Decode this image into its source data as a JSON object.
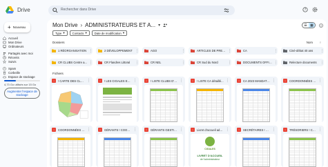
{
  "app": {
    "title": "Drive"
  },
  "search": {
    "placeholder": "Rechercher dans Drive"
  },
  "sidebar": {
    "new_label": "Nouveau",
    "items": [
      {
        "label": "Accueil",
        "icon": "home-icon"
      },
      {
        "label": "Mon Drive",
        "icon": "drive-icon"
      },
      {
        "label": "Ordinateurs",
        "icon": "computer-icon"
      },
      {
        "label": "Partagés avec moi",
        "icon": "people-icon"
      },
      {
        "label": "Récents",
        "icon": "clock-icon"
      },
      {
        "label": "Suivis",
        "icon": "star-icon"
      },
      {
        "label": "Spam",
        "icon": "spam-icon"
      },
      {
        "label": "Corbeille",
        "icon": "trash-icon"
      },
      {
        "label": "Espace de stockage",
        "icon": "cloud-icon"
      }
    ],
    "storage_text": "4,73 Go utilisés sur 15 Go",
    "storage_fraction": 0.32,
    "storage_button": "Augmenter l'espace de stockage"
  },
  "breadcrumb": {
    "root": "Mon Drive",
    "separator": "›",
    "current": "ADMINISTRATEURS ET A..."
  },
  "filters": {
    "type": "Type",
    "contacts": "Contacts",
    "modified": "Date de modification"
  },
  "sections": {
    "folders": "Dossiers",
    "files": "Fichiers"
  },
  "sort": {
    "label": "Nom",
    "direction": "↑"
  },
  "folders": [
    {
      "name": "1 RÉORGANISATION",
      "color": "#f4b400"
    },
    {
      "name": "2 DÉVELOPPEMENT",
      "color": "#f4b400"
    },
    {
      "name": "AGO",
      "color": "#db4437"
    },
    {
      "name": "ARTICLES DE PRESSE",
      "color": "#db4437"
    },
    {
      "name": "CA",
      "color": "#db4437"
    },
    {
      "name": "Ciné-débat 40 ans",
      "color": "#5f6368"
    },
    {
      "name": "CR CLUBS Centre a...",
      "color": "#f4b400"
    },
    {
      "name": "CR Flandres Littoral",
      "color": "#db4437"
    },
    {
      "name": "CR NEL",
      "color": "#db4437"
    },
    {
      "name": "CR Sud du Nord",
      "color": "#db4437"
    },
    {
      "name": "DOCUMENTS OFFIC...",
      "color": "#db4437"
    },
    {
      "name": "Relecture documents",
      "color": "#5f6368"
    }
  ],
  "files": [
    {
      "name": "! CARTE DES CLUB..."
    },
    {
      "name": "! LES CIGALES EN ..."
    },
    {
      "name": "! LISTE CLUBS D'A..."
    },
    {
      "name": "! LISTE CA détaillé..."
    },
    {
      "name": "CA 2023 MANDATS..."
    },
    {
      "name": "COORDONNÉES AD..."
    },
    {
      "name": "COORDONNÉES CL..."
    },
    {
      "name": "GÉRANTS ! COOR..."
    },
    {
      "name": "GÉRANTS GESTION..."
    },
    {
      "name": "Livret d'accueil adm..."
    },
    {
      "name": "SECRÉTAIRES ! CE..."
    },
    {
      "name": "TRÉSORIERS ! CE..."
    }
  ],
  "livret": {
    "brand": "CIGALES",
    "heading": "LIVRET D'ACCUEIL",
    "subheading": "de l'administrateur"
  }
}
